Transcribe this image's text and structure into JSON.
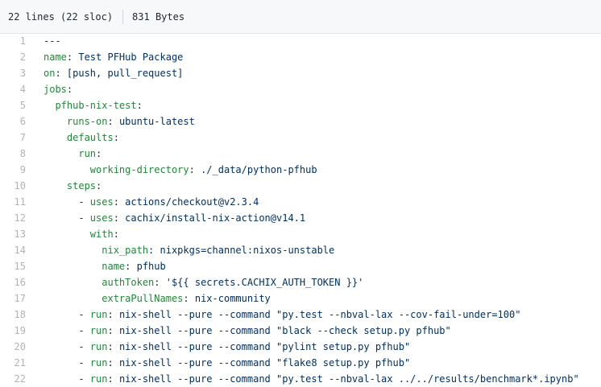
{
  "file_info": {
    "lines": "22 lines (22 sloc)",
    "size": "831 Bytes"
  },
  "colors": {
    "key": "#22863a",
    "value": "#032f62",
    "line_number": "#959da5",
    "header_bg": "#f6f8fa"
  },
  "code_lines": [
    {
      "num": "1",
      "indent": "",
      "key": "",
      "sep": "---",
      "value": ""
    },
    {
      "num": "2",
      "indent": "",
      "key": "name",
      "sep": ": ",
      "value": "Test PFHub Package"
    },
    {
      "num": "3",
      "indent": "",
      "key": "on",
      "sep": ": ",
      "value": "[push, pull_request]"
    },
    {
      "num": "4",
      "indent": "",
      "key": "jobs",
      "sep": ":",
      "value": ""
    },
    {
      "num": "5",
      "indent": "  ",
      "key": "pfhub-nix-test",
      "sep": ":",
      "value": ""
    },
    {
      "num": "6",
      "indent": "    ",
      "key": "runs-on",
      "sep": ": ",
      "value": "ubuntu-latest"
    },
    {
      "num": "7",
      "indent": "    ",
      "key": "defaults",
      "sep": ":",
      "value": ""
    },
    {
      "num": "8",
      "indent": "      ",
      "key": "run",
      "sep": ":",
      "value": ""
    },
    {
      "num": "9",
      "indent": "        ",
      "key": "working-directory",
      "sep": ": ",
      "value": "./_data/python-pfhub"
    },
    {
      "num": "10",
      "indent": "    ",
      "key": "steps",
      "sep": ":",
      "value": ""
    },
    {
      "num": "11",
      "indent": "      - ",
      "key": "uses",
      "sep": ": ",
      "value": "actions/checkout@v2.3.4"
    },
    {
      "num": "12",
      "indent": "      - ",
      "key": "uses",
      "sep": ": ",
      "value": "cachix/install-nix-action@v14.1"
    },
    {
      "num": "13",
      "indent": "        ",
      "key": "with",
      "sep": ":",
      "value": ""
    },
    {
      "num": "14",
      "indent": "          ",
      "key": "nix_path",
      "sep": ": ",
      "value": "nixpkgs=channel:nixos-unstable"
    },
    {
      "num": "15",
      "indent": "          ",
      "key": "name",
      "sep": ": ",
      "value": "pfhub"
    },
    {
      "num": "16",
      "indent": "          ",
      "key": "authToken",
      "sep": ": ",
      "value": "'${{ secrets.CACHIX_AUTH_TOKEN }}'"
    },
    {
      "num": "17",
      "indent": "          ",
      "key": "extraPullNames",
      "sep": ": ",
      "value": "nix-community"
    },
    {
      "num": "18",
      "indent": "      - ",
      "key": "run",
      "sep": ": ",
      "value": "nix-shell --pure --command \"py.test --nbval-lax --cov-fail-under=100\""
    },
    {
      "num": "19",
      "indent": "      - ",
      "key": "run",
      "sep": ": ",
      "value": "nix-shell --pure --command \"black --check setup.py pfhub\""
    },
    {
      "num": "20",
      "indent": "      - ",
      "key": "run",
      "sep": ": ",
      "value": "nix-shell --pure --command \"pylint setup.py pfhub\""
    },
    {
      "num": "21",
      "indent": "      - ",
      "key": "run",
      "sep": ": ",
      "value": "nix-shell --pure --command \"flake8 setup.py pfhub\""
    },
    {
      "num": "22",
      "indent": "      - ",
      "key": "run",
      "sep": ": ",
      "value": "nix-shell --pure --command \"py.test --nbval-lax ../../results/benchmark*.ipynb\""
    }
  ]
}
